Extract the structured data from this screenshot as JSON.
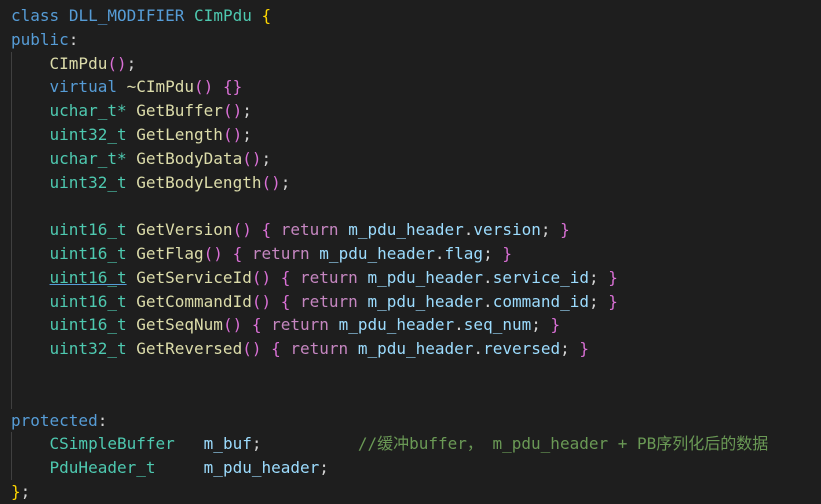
{
  "code": {
    "l1": {
      "kw": "class",
      "macro": "DLL_MODIFIER",
      "cls": "CImPdu",
      "brace": "{"
    },
    "l2": {
      "kw": "public",
      "colon": ":"
    },
    "l3": {
      "fn": "CImPdu",
      "parens": "()",
      "semi": ";"
    },
    "l4": {
      "kw": "virtual",
      "fn": "~CImPdu",
      "parens": "()",
      "braces": "{}"
    },
    "l5": {
      "ty": "uchar_t*",
      "fn": "GetBuffer",
      "parens": "()",
      "semi": ";"
    },
    "l6": {
      "ty": "uint32_t",
      "fn": "GetLength",
      "parens": "()",
      "semi": ";"
    },
    "l7": {
      "ty": "uchar_t*",
      "fn": "GetBodyData",
      "parens": "()",
      "semi": ";"
    },
    "l8": {
      "ty": "uint32_t",
      "fn": "GetBodyLength",
      "parens": "()",
      "semi": ";"
    },
    "l10": {
      "ty": "uint16_t",
      "fn": "GetVersion",
      "parens": "()",
      "open": "{",
      "ret": "return",
      "obj": "m_pdu_header",
      "dot": ".",
      "field": "version",
      "semi": ";",
      "close": "}"
    },
    "l11": {
      "ty": "uint16_t",
      "fn": "GetFlag",
      "parens": "()",
      "open": "{",
      "ret": "return",
      "obj": "m_pdu_header",
      "dot": ".",
      "field": "flag",
      "semi": ";",
      "close": "}"
    },
    "l12": {
      "ty": "uint16_t",
      "fn": "GetServiceId",
      "parens": "()",
      "open": "{",
      "ret": "return",
      "obj": "m_pdu_header",
      "dot": ".",
      "field": "service_id",
      "semi": ";",
      "close": "}"
    },
    "l13": {
      "ty": "uint16_t",
      "fn": "GetCommandId",
      "parens": "()",
      "open": "{",
      "ret": "return",
      "obj": "m_pdu_header",
      "dot": ".",
      "field": "command_id",
      "semi": ";",
      "close": "}"
    },
    "l14": {
      "ty": "uint16_t",
      "fn": "GetSeqNum",
      "parens": "()",
      "open": "{",
      "ret": "return",
      "obj": "m_pdu_header",
      "dot": ".",
      "field": "seq_num",
      "semi": ";",
      "close": "}"
    },
    "l15": {
      "ty": "uint32_t",
      "fn": "GetReversed",
      "parens": "()",
      "open": "{",
      "ret": "return",
      "obj": "m_pdu_header",
      "dot": ".",
      "field": "reversed",
      "semi": ";",
      "close": "}"
    },
    "l18": {
      "kw": "protected",
      "colon": ":"
    },
    "l19": {
      "ty": "CSimpleBuffer",
      "var": "m_buf",
      "semi": ";",
      "comment": "//缓冲buffer， m_pdu_header + PB序列化后的数据"
    },
    "l20": {
      "ty": "PduHeader_t",
      "var": "m_pdu_header",
      "semi": ";"
    },
    "l21": {
      "brace": "}",
      "semi": ";"
    }
  },
  "colors": {
    "background": "#1e1e1e",
    "keyword": "#569cd6",
    "type": "#4ec9b0",
    "function": "#dcdcaa",
    "variable": "#9cdcfe",
    "control": "#c586c0",
    "comment": "#6a9955",
    "bracket_gold": "#ffd700",
    "bracket_pink": "#da70d6"
  }
}
